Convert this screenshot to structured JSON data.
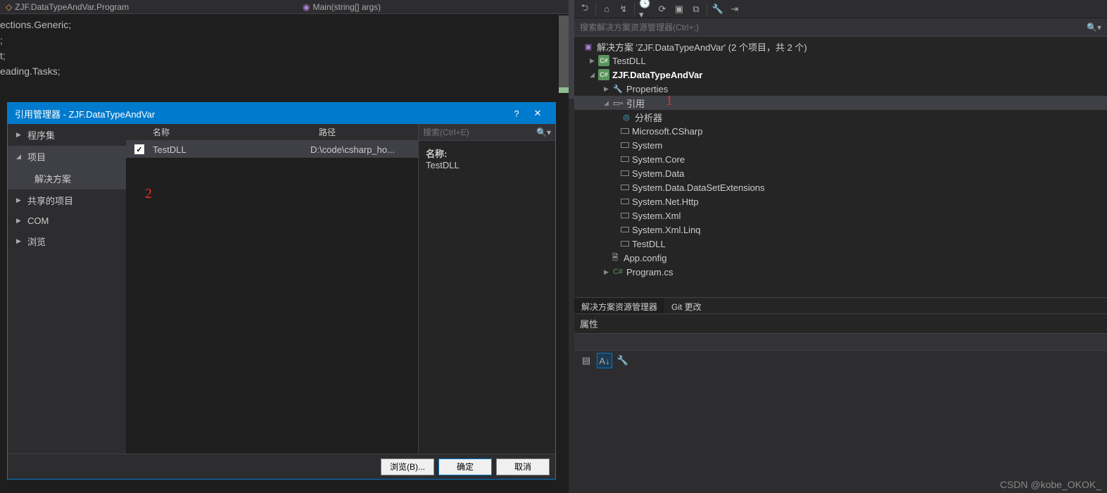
{
  "editor": {
    "nav_left": "ZJF.DataTypeAndVar.Program",
    "nav_right": "Main(string[] args)",
    "lines": [
      "ections.Generic;",
      ";",
      "t;",
      "eading.Tasks;"
    ]
  },
  "dialog": {
    "title": "引用管理器 - ZJF.DataTypeAndVar",
    "help": "?",
    "close": "✕",
    "nav": {
      "assemblies": "程序集",
      "projects": "项目",
      "solution": "解决方案",
      "shared": "共享的项目",
      "com": "COM",
      "browse": "浏览"
    },
    "columns": {
      "name": "名称",
      "path": "路径"
    },
    "row": {
      "name": "TestDLL",
      "path": "D:\\code\\csharp_ho..."
    },
    "search_placeholder": "搜索(Ctrl+E)",
    "info_label": "名称:",
    "info_value": "TestDLL",
    "buttons": {
      "browse": "浏览(B)...",
      "ok": "确定",
      "cancel": "取消"
    },
    "anno2": "2"
  },
  "solution": {
    "toolbar_icons": [
      "back-icon",
      "home-icon",
      "sync-icon",
      "history-icon",
      "refresh-icon",
      "collapse-icon",
      "show-all-icon",
      "properties-icon",
      "preview-icon"
    ],
    "search_placeholder": "搜索解决方案资源管理器(Ctrl+;)",
    "root": "解决方案 'ZJF.DataTypeAndVar' (2 个项目，共 2 个)",
    "proj1": "TestDLL",
    "proj2": "ZJF.DataTypeAndVar",
    "properties": "Properties",
    "references": "引用",
    "anno1": "1",
    "ref_items": [
      "分析器",
      "Microsoft.CSharp",
      "System",
      "System.Core",
      "System.Data",
      "System.Data.DataSetExtensions",
      "System.Net.Http",
      "System.Xml",
      "System.Xml.Linq",
      "TestDLL"
    ],
    "appconfig": "App.config",
    "program": "Program.cs"
  },
  "panel_tabs": {
    "sln": "解决方案资源管理器",
    "git": "Git 更改"
  },
  "props": {
    "title": "属性"
  },
  "watermark": "CSDN @kobe_OKOK_"
}
